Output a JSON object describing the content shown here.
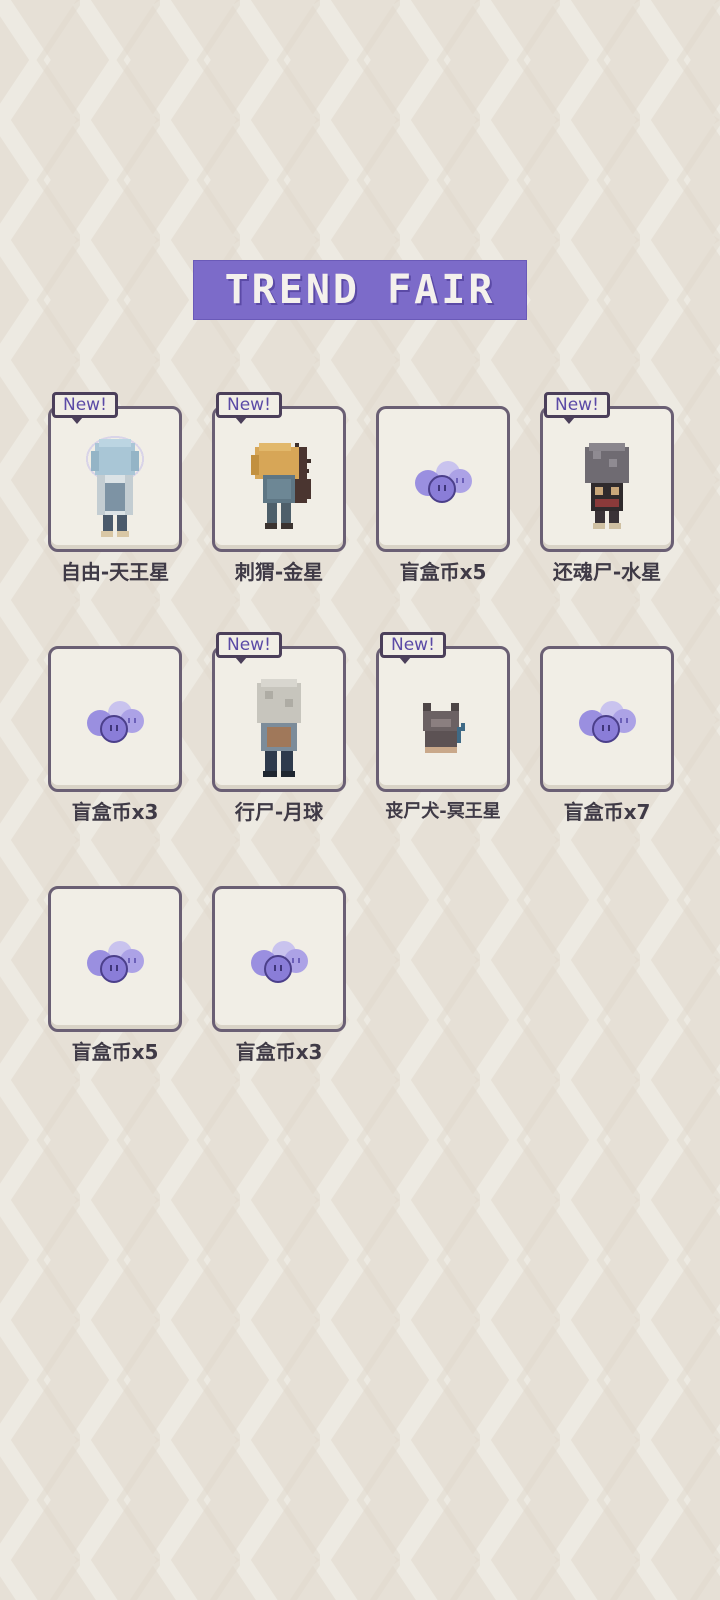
{
  "title": "TREND FAIR",
  "colors": {
    "accent": "#7c6bc9",
    "background": "#e6e0d6",
    "card": "#f1eee6",
    "card_border": "#6a5f74",
    "text": "#3f3a46"
  },
  "items": [
    {
      "label": "自由-天王星",
      "new": true,
      "new_label": "New!",
      "icon": "character-uranus-icon"
    },
    {
      "label": "刺猬-金星",
      "new": true,
      "new_label": "New!",
      "icon": "character-venus-icon"
    },
    {
      "label": "盲盒币x5",
      "new": false,
      "icon": "blind-box-coin-icon"
    },
    {
      "label": "还魂尸-水星",
      "new": true,
      "new_label": "New!",
      "icon": "character-mercury-icon"
    },
    {
      "label": "盲盒币x3",
      "new": false,
      "icon": "blind-box-coin-icon"
    },
    {
      "label": "行尸-月球",
      "new": true,
      "new_label": "New!",
      "icon": "character-moon-icon"
    },
    {
      "label": "丧尸犬-冥王星",
      "new": true,
      "new_label": "New!",
      "icon": "character-pluto-dog-icon"
    },
    {
      "label": "盲盒币x7",
      "new": false,
      "icon": "blind-box-coin-icon"
    },
    {
      "label": "盲盒币x5",
      "new": false,
      "icon": "blind-box-coin-icon"
    },
    {
      "label": "盲盒币x3",
      "new": false,
      "icon": "blind-box-coin-icon"
    }
  ]
}
